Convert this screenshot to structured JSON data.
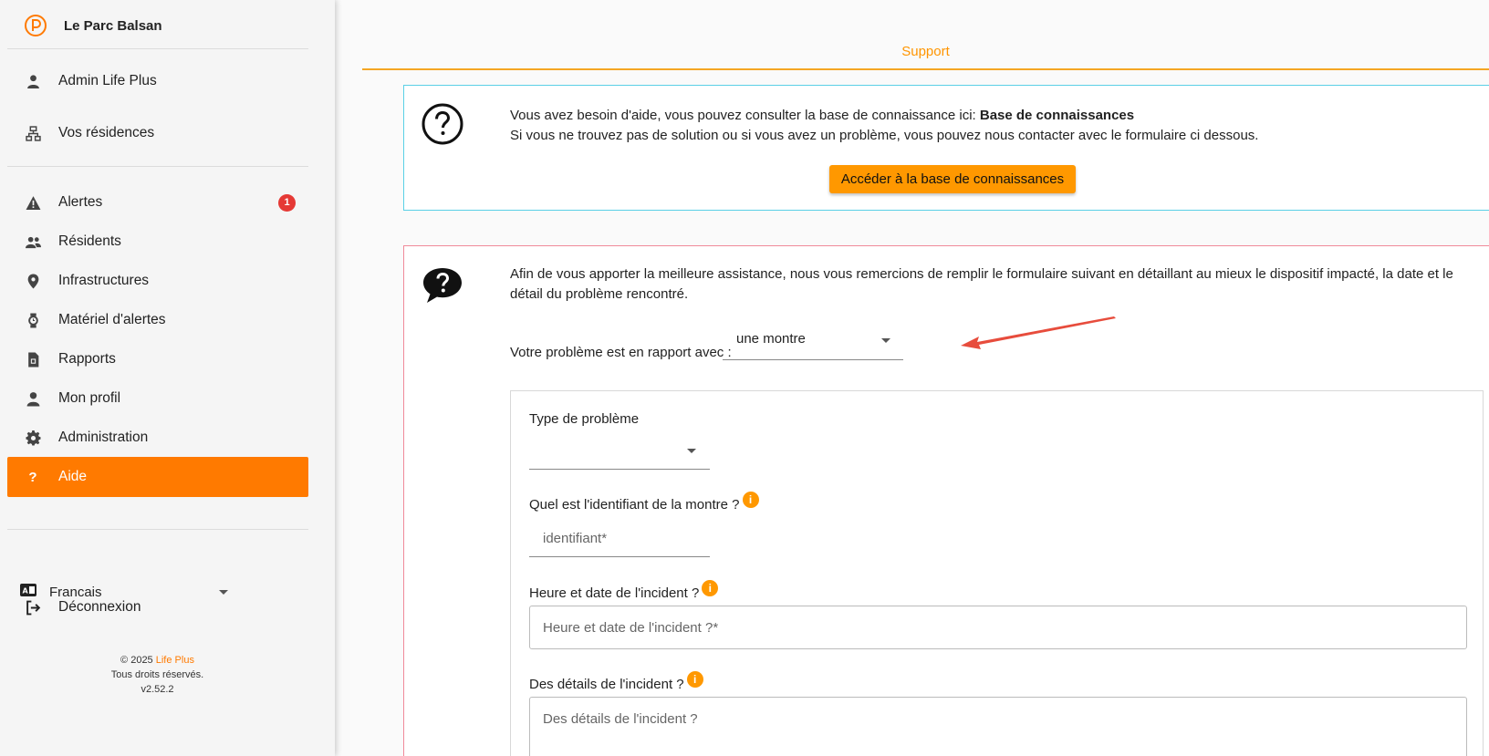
{
  "brand": {
    "name": "Le Parc Balsan",
    "logo_color": "#ff7a00"
  },
  "sidebar": {
    "top_items": [
      {
        "label": "Admin Life Plus",
        "icon": "admin-user-icon"
      },
      {
        "label": "Vos résidences",
        "icon": "sitemap-icon"
      }
    ],
    "items": [
      {
        "label": "Alertes",
        "icon": "warning-icon",
        "badge": "1"
      },
      {
        "label": "Résidents",
        "icon": "users-icon"
      },
      {
        "label": "Infrastructures",
        "icon": "location-pin-icon"
      },
      {
        "label": "Matériel d'alertes",
        "icon": "watch-icon"
      },
      {
        "label": "Rapports",
        "icon": "report-file-icon"
      },
      {
        "label": "Mon profil",
        "icon": "person-icon"
      },
      {
        "label": "Administration",
        "icon": "gear-icon"
      },
      {
        "label": "Aide",
        "icon": "question-icon",
        "active": true,
        "glyph": "?"
      }
    ],
    "language": {
      "label": "Francais",
      "icon": "language-icon"
    },
    "logout": {
      "label": "Déconnexion",
      "icon": "logout-icon"
    },
    "footer": {
      "copyright": "© 2025",
      "brand": "Life Plus",
      "rights": "Tous droits réservés.",
      "version": "v2.52.2"
    },
    "accent": "#ff7a00"
  },
  "main": {
    "tab": "Support",
    "info": {
      "line1_prefix": "Vous avez besoin d'aide, vous pouvez consulter la base de connaissance ici: ",
      "line1_bold": "Base de connaissances",
      "line2": "Si vous ne trouvez pas de solution ou si vous avez un problème, vous pouvez nous contacter avec le formulaire ci dessous.",
      "button": "Accéder à la base de connaissances"
    },
    "form": {
      "intro": "Afin de vous apporter la meilleure assistance, nous vous remercions de remplir le formulaire suivant en détaillant au mieux le dispositif impacté, la date et le détail du problème rencontré.",
      "related_label": "Votre problème est en rapport avec :",
      "related_value": "une montre",
      "type_label": "Type de problème",
      "type_value": "",
      "id_label": "Quel est l'identifiant de la montre ?",
      "id_placeholder": "identifiant*",
      "date_label": "Heure et date de l'incident ?",
      "date_placeholder": "Heure et date de l'incident ?*",
      "details_label": "Des détails de l'incident ?",
      "details_placeholder": "Des détails de l'incident ?",
      "tip_glyph": "i"
    }
  },
  "colors": {
    "info_border": "#5ad0e6",
    "form_border": "#f08a9a",
    "button": "#ff9800",
    "arrow": "#e74c3c"
  }
}
